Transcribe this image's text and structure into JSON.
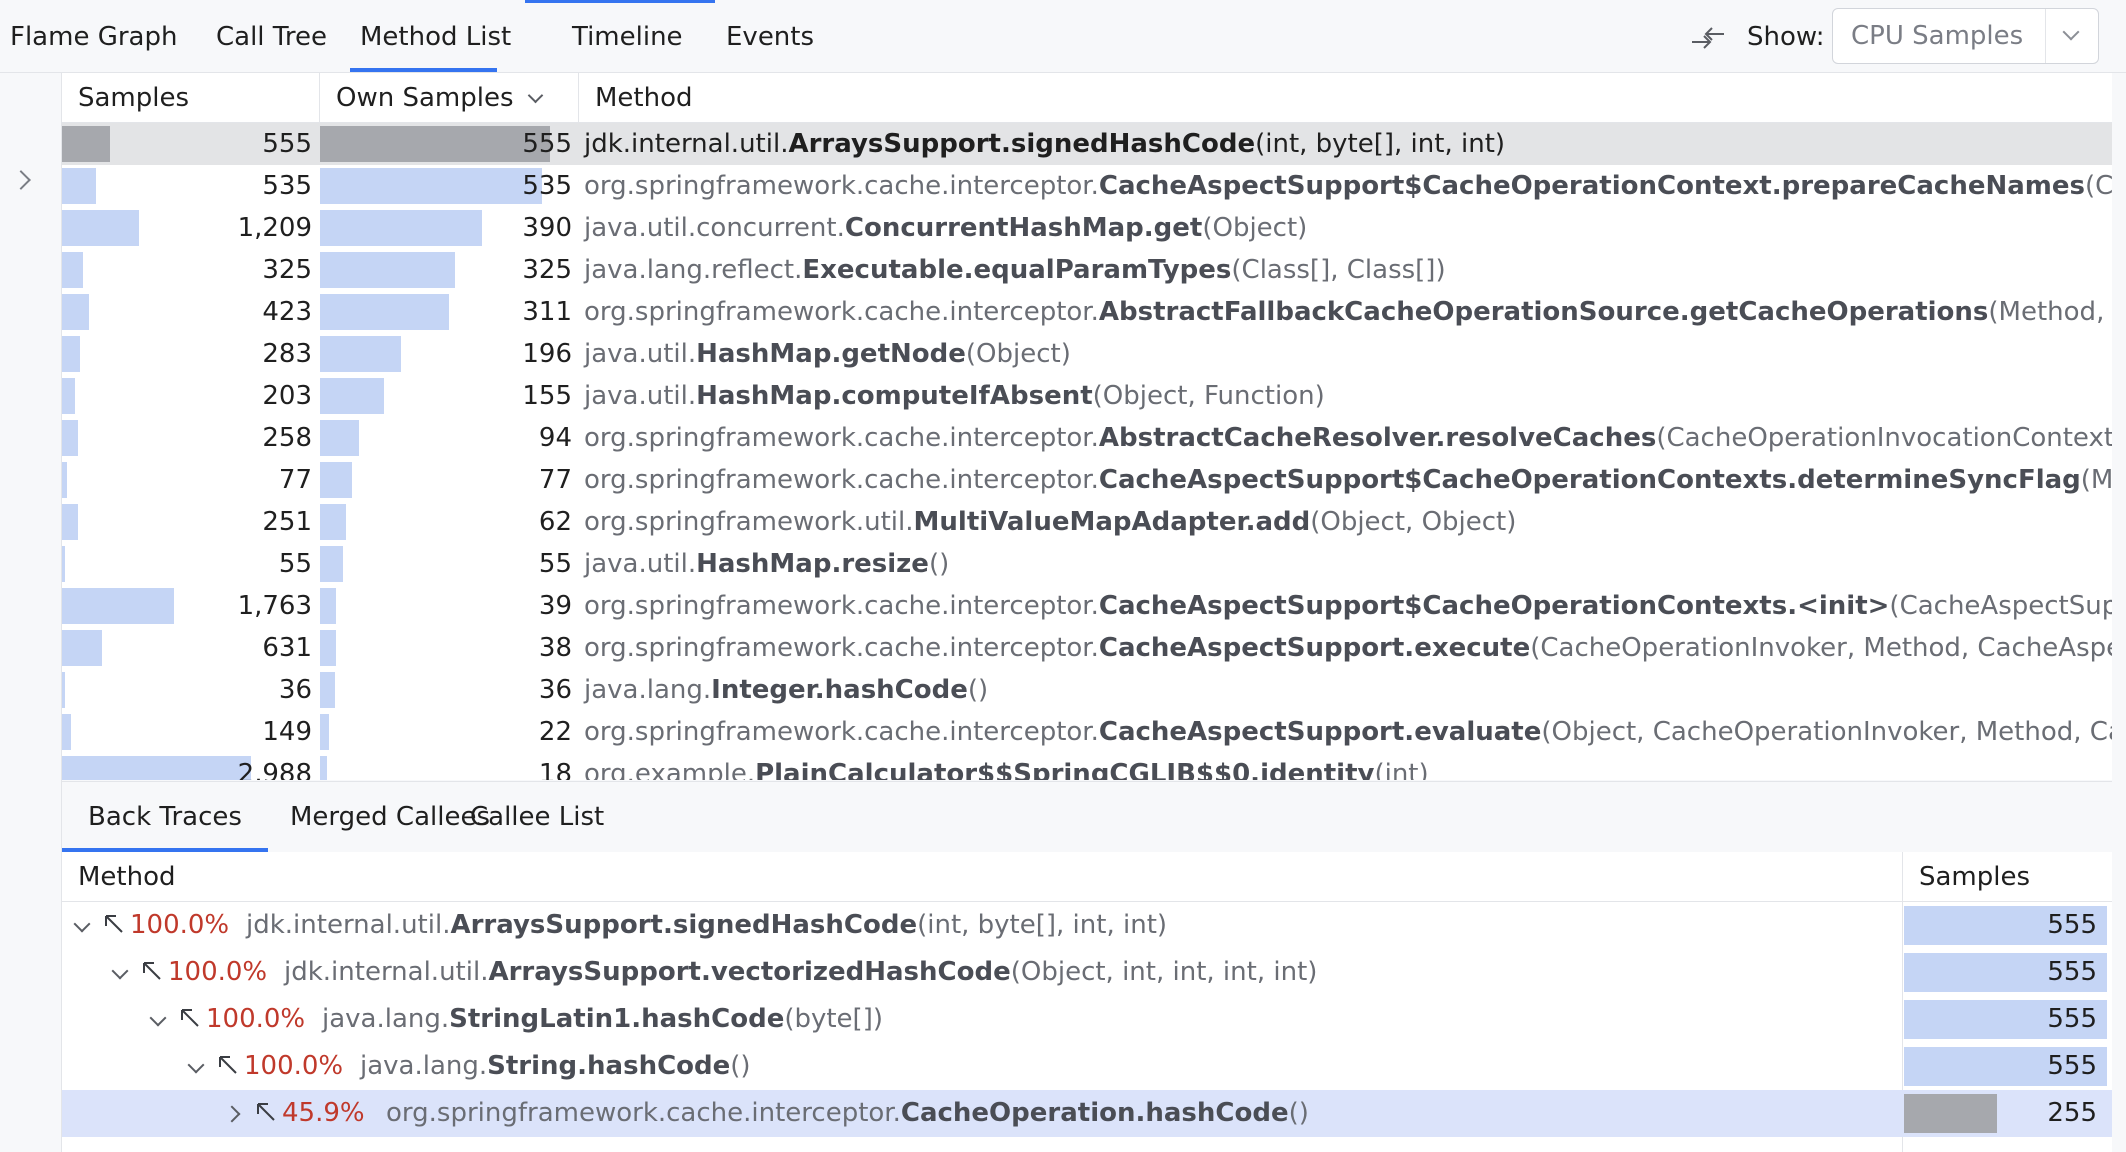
{
  "tabs": {
    "flame_graph": "Flame Graph",
    "call_tree": "Call Tree",
    "method_list": "Method List",
    "timeline": "Timeline",
    "events": "Events"
  },
  "show": {
    "label": "Show:",
    "value": "CPU Samples"
  },
  "grid": {
    "columns": {
      "samples": "Samples",
      "own_samples": "Own Samples",
      "method": "Method"
    },
    "max_samples": 3000,
    "max_own": 555,
    "rows": [
      {
        "samples": "555",
        "samples_n": 555,
        "own": "555",
        "own_n": 555,
        "pkg": "jdk.internal.util.",
        "name": "ArraysSupport.signedHashCode",
        "args": "(int, byte[], int, int)"
      },
      {
        "samples": "535",
        "samples_n": 535,
        "own": "535",
        "own_n": 535,
        "pkg": "org.springframework.cache.interceptor.",
        "name": "CacheAspectSupport$CacheOperationContext.prepareCacheNames",
        "args": "(Collection)"
      },
      {
        "samples": "1,209",
        "samples_n": 1209,
        "own": "390",
        "own_n": 390,
        "pkg": "java.util.concurrent.",
        "name": "ConcurrentHashMap.get",
        "args": "(Object)"
      },
      {
        "samples": "325",
        "samples_n": 325,
        "own": "325",
        "own_n": 325,
        "pkg": "java.lang.reflect.",
        "name": "Executable.equalParamTypes",
        "args": "(Class[], Class[])"
      },
      {
        "samples": "423",
        "samples_n": 423,
        "own": "311",
        "own_n": 311,
        "pkg": "org.springframework.cache.interceptor.",
        "name": "AbstractFallbackCacheOperationSource.getCacheOperations",
        "args": "(Method, Class)"
      },
      {
        "samples": "283",
        "samples_n": 283,
        "own": "196",
        "own_n": 196,
        "pkg": "java.util.",
        "name": "HashMap.getNode",
        "args": "(Object)"
      },
      {
        "samples": "203",
        "samples_n": 203,
        "own": "155",
        "own_n": 155,
        "pkg": "java.util.",
        "name": "HashMap.computeIfAbsent",
        "args": "(Object, Function)"
      },
      {
        "samples": "258",
        "samples_n": 258,
        "own": "94",
        "own_n": 94,
        "pkg": "org.springframework.cache.interceptor.",
        "name": "AbstractCacheResolver.resolveCaches",
        "args": "(CacheOperationInvocationContext)"
      },
      {
        "samples": "77",
        "samples_n": 77,
        "own": "77",
        "own_n": 77,
        "pkg": "org.springframework.cache.interceptor.",
        "name": "CacheAspectSupport$CacheOperationContexts.determineSyncFlag",
        "args": "(Method)"
      },
      {
        "samples": "251",
        "samples_n": 251,
        "own": "62",
        "own_n": 62,
        "pkg": "org.springframework.util.",
        "name": "MultiValueMapAdapter.add",
        "args": "(Object, Object)"
      },
      {
        "samples": "55",
        "samples_n": 55,
        "own": "55",
        "own_n": 55,
        "pkg": "java.util.",
        "name": "HashMap.resize",
        "args": "()"
      },
      {
        "samples": "1,763",
        "samples_n": 1763,
        "own": "39",
        "own_n": 39,
        "pkg": "org.springframework.cache.interceptor.",
        "name": "CacheAspectSupport$CacheOperationContexts.<init>",
        "args": "(CacheAspectSupport, Colle"
      },
      {
        "samples": "631",
        "samples_n": 631,
        "own": "38",
        "own_n": 38,
        "pkg": "org.springframework.cache.interceptor.",
        "name": "CacheAspectSupport.execute",
        "args": "(CacheOperationInvoker, Method, CacheAspectSupp"
      },
      {
        "samples": "36",
        "samples_n": 36,
        "own": "36",
        "own_n": 36,
        "pkg": "java.lang.",
        "name": "Integer.hashCode",
        "args": "()"
      },
      {
        "samples": "149",
        "samples_n": 149,
        "own": "22",
        "own_n": 22,
        "pkg": "org.springframework.cache.interceptor.",
        "name": "CacheAspectSupport.evaluate",
        "args": "(Object, CacheOperationInvoker, Method, CacheAsp"
      },
      {
        "samples": "2,988",
        "samples_n": 2988,
        "own": "18",
        "own_n": 18,
        "pkg": "org.example.",
        "name": "PlainCalculator$$SpringCGLIB$$0.identity",
        "args": "(int)"
      }
    ]
  },
  "bottom_tabs": {
    "back_traces": "Back Traces",
    "merged_callees": "Merged Callees",
    "callee_list": "Callee List"
  },
  "tree": {
    "columns": {
      "method": "Method",
      "samples": "Samples"
    },
    "rows": [
      {
        "depth": 0,
        "expanded": true,
        "pct": "100.0%",
        "pkg": "jdk.internal.util.",
        "name": "ArraysSupport.signedHashCode",
        "args": "(int, byte[], int, int)",
        "samples": "555",
        "fraction": 1.0
      },
      {
        "depth": 1,
        "expanded": true,
        "pct": "100.0%",
        "pkg": "jdk.internal.util.",
        "name": "ArraysSupport.vectorizedHashCode",
        "args": "(Object, int, int, int, int)",
        "samples": "555",
        "fraction": 1.0
      },
      {
        "depth": 2,
        "expanded": true,
        "pct": "100.0%",
        "pkg": "java.lang.",
        "name": "StringLatin1.hashCode",
        "args": "(byte[])",
        "samples": "555",
        "fraction": 1.0
      },
      {
        "depth": 3,
        "expanded": true,
        "pct": "100.0%",
        "pkg": "java.lang.",
        "name": "String.hashCode",
        "args": "()",
        "samples": "555",
        "fraction": 1.0
      },
      {
        "depth": 4,
        "expanded": false,
        "pct": "45.9%",
        "pkg": "org.springframework.cache.interceptor.",
        "name": "CacheOperation.hashCode",
        "args": "()",
        "samples": "255",
        "fraction": 0.459
      }
    ]
  }
}
